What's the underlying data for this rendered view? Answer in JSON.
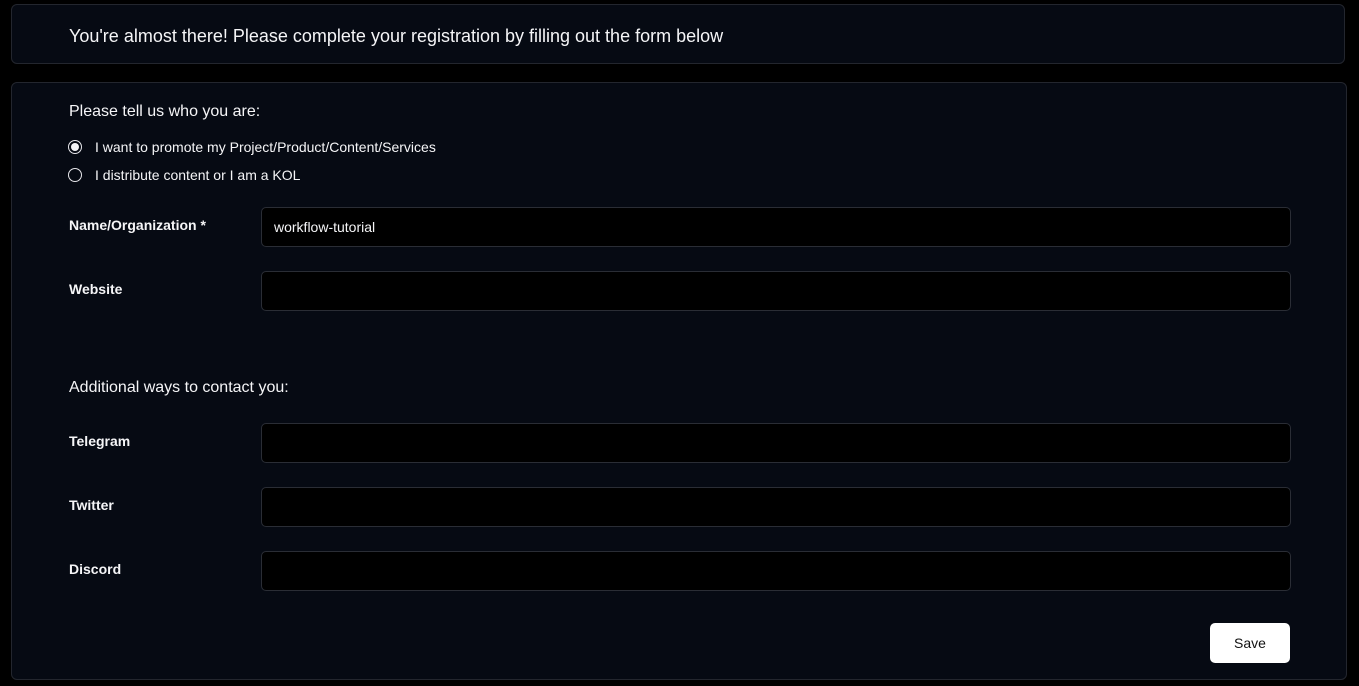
{
  "banner": {
    "text": "You're almost there! Please complete your registration by filling out the form below"
  },
  "form": {
    "who_title": "Please tell us who you are:",
    "radio_options": [
      {
        "label": "I want to promote my Project/Product/Content/Services",
        "selected": true
      },
      {
        "label": "I distribute content or I am a KOL",
        "selected": false
      }
    ],
    "fields": {
      "name": {
        "label": "Name/Organization *",
        "value": "workflow-tutorial",
        "placeholder": ""
      },
      "website": {
        "label": "Website",
        "value": "",
        "placeholder": ""
      }
    },
    "contact_title": "Additional ways to contact you:",
    "contact_fields": {
      "telegram": {
        "label": "Telegram",
        "value": "",
        "placeholder": ""
      },
      "twitter": {
        "label": "Twitter",
        "value": "",
        "placeholder": ""
      },
      "discord": {
        "label": "Discord",
        "value": "",
        "placeholder": ""
      }
    },
    "save_label": "Save"
  },
  "colors": {
    "background": "#000000",
    "panel": "#060a13",
    "panel_border": "#23262e",
    "input_border": "#2a2d35",
    "text": "#f5f5f7",
    "button_bg": "#ffffff",
    "button_text": "#111111"
  }
}
